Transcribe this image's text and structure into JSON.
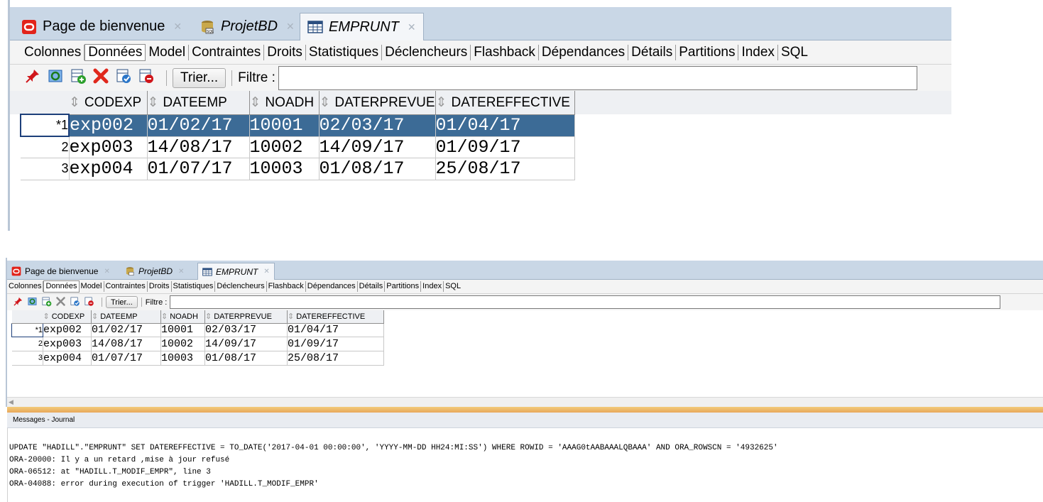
{
  "tabs": [
    {
      "label": "Page de bienvenue",
      "icon": "oracle-icon",
      "italic": false
    },
    {
      "label": "ProjetBD",
      "icon": "database-connection-icon",
      "italic": true
    },
    {
      "label": "EMPRUNT",
      "icon": "table-icon",
      "italic": true
    }
  ],
  "subtabs": [
    "Colonnes",
    "Données",
    "Model",
    "Contraintes",
    "Droits",
    "Statistiques",
    "Déclencheurs",
    "Flashback",
    "Dépendances",
    "Détails",
    "Partitions",
    "Index",
    "SQL"
  ],
  "toolbar": {
    "icons": [
      "pin-icon",
      "refresh-icon",
      "insert-row-icon",
      "delete-row-icon",
      "commit-icon",
      "rollback-icon"
    ],
    "sort_label": "Trier...",
    "filter_label": "Filtre :"
  },
  "grid": {
    "columns": [
      "CODEXP",
      "DATEEMP",
      "NOADH",
      "DATERPREVUE",
      "DATEREFFECTIVE"
    ],
    "rows": [
      {
        "num": "*1",
        "cells": [
          "exp002",
          "01/02/17",
          "10001",
          "02/03/17",
          "01/04/17"
        ]
      },
      {
        "num": "2",
        "cells": [
          "exp003",
          "14/08/17",
          "10002",
          "14/09/17",
          "01/09/17"
        ]
      },
      {
        "num": "3",
        "cells": [
          "exp004",
          "01/07/17",
          "10003",
          "01/08/17",
          "25/08/17"
        ]
      }
    ]
  },
  "messages": {
    "header": "Messages - Journal",
    "lines": [
      "UPDATE \"HADILL\".\"EMPRUNT\" SET DATEREFFECTIVE = TO_DATE('2017-04-01 00:00:00', 'YYYY-MM-DD HH24:MI:SS') WHERE ROWID = 'AAAG0tAABAAALQBAAA' AND ORA_ROWSCN = '4932625'",
      "ORA-20000: Il y a un retard ,mise à jour refusé",
      "ORA-06512: at \"HADILL.T_MODIF_EMPR\", line 3",
      "ORA-04088: error during execution of trigger 'HADILL.T_MODIF_EMPR'"
    ]
  },
  "colors": {
    "tabbar": "#c9d7e6",
    "selection": "#3c6b96",
    "splitter": "#e8a85a"
  }
}
